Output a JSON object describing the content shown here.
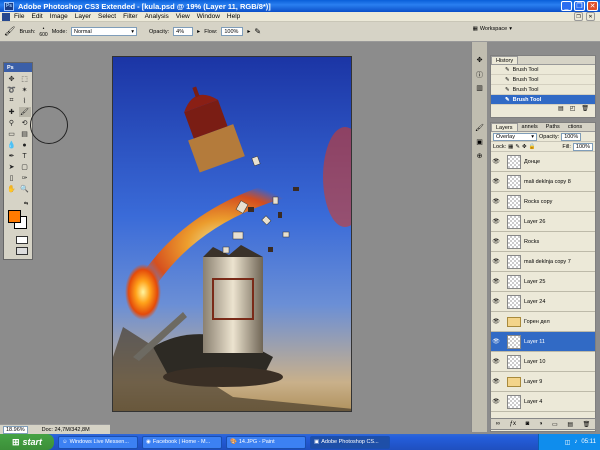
{
  "window": {
    "title": "Adobe Photoshop CS3 Extended - [kula.psd @ 19% (Layer 11, RGB/8*)]"
  },
  "menu": [
    "File",
    "Edit",
    "Image",
    "Layer",
    "Select",
    "Filter",
    "Analysis",
    "View",
    "Window",
    "Help"
  ],
  "options": {
    "brush_label": "Brush:",
    "brush_size": "600",
    "mode_label": "Mode:",
    "mode_value": "Normal",
    "opacity_label": "Opacity:",
    "opacity_value": "4%",
    "flow_label": "Flow:",
    "flow_value": "100%",
    "workspace_label": "Workspace"
  },
  "tools": {
    "header": "Ps",
    "foreground_color": "#ff7a00",
    "background_color": "#ffffff"
  },
  "history": {
    "tab": "History",
    "items": [
      "Brush Tool",
      "Brush Tool",
      "Brush Tool",
      "Brush Tool"
    ],
    "selected_index": 3
  },
  "layers": {
    "tabs": [
      "Layers",
      "annels",
      "Paths",
      "ctions"
    ],
    "blend_mode": "Overlay",
    "opacity_label": "Opacity:",
    "opacity_value": "100%",
    "lock_label": "Lock:",
    "fill_label": "Fill:",
    "fill_value": "100%",
    "items": [
      {
        "name": "Донце",
        "type": "layer"
      },
      {
        "name": "mali deklnja copy 8",
        "type": "layer"
      },
      {
        "name": "Rocks copy",
        "type": "layer"
      },
      {
        "name": "Layer 26",
        "type": "layer"
      },
      {
        "name": "Rocks",
        "type": "layer"
      },
      {
        "name": "mali deklnja copy 7",
        "type": "layer"
      },
      {
        "name": "Layer 25",
        "type": "layer"
      },
      {
        "name": "Layer 24",
        "type": "layer"
      },
      {
        "name": "Горен дел",
        "type": "group"
      },
      {
        "name": "Layer 11",
        "type": "layer"
      },
      {
        "name": "Layer 10",
        "type": "layer"
      },
      {
        "name": "Layer 9",
        "type": "group"
      },
      {
        "name": "Layer 4",
        "type": "layer"
      }
    ],
    "selected_index": 9
  },
  "status": {
    "zoom": "18.96%",
    "doc": "Doc: 24,7M/342,8M"
  },
  "taskbar": {
    "start": "start",
    "tasks": [
      "Windows Live Messen...",
      "Facebook | Home - M...",
      "14.JPG - Paint",
      "Adobe Photoshop CS..."
    ],
    "active_index": 3,
    "clock": "05:11"
  }
}
